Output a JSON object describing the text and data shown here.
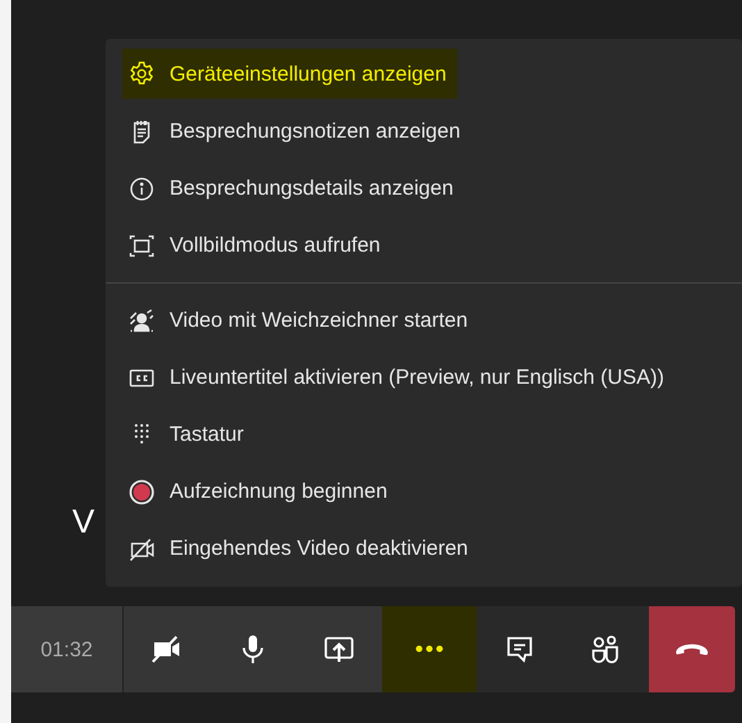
{
  "background_text": "V",
  "menu": {
    "groups": [
      [
        {
          "kind": "settings",
          "label": "Geräteeinstellungen anzeigen",
          "selected": true
        },
        {
          "kind": "notes",
          "label": "Besprechungsnotizen anzeigen",
          "selected": false
        },
        {
          "kind": "info",
          "label": "Besprechungsdetails anzeigen",
          "selected": false
        },
        {
          "kind": "fullscreen",
          "label": "Vollbildmodus aufrufen",
          "selected": false
        }
      ],
      [
        {
          "kind": "blur",
          "label": "Video mit Weichzeichner starten",
          "selected": false
        },
        {
          "kind": "captions",
          "label": "Liveuntertitel aktivieren (Preview, nur Englisch (USA))",
          "selected": false
        },
        {
          "kind": "keypad",
          "label": "Tastatur",
          "selected": false
        },
        {
          "kind": "record",
          "label": "Aufzeichnung beginnen",
          "selected": false
        },
        {
          "kind": "video-off",
          "label": "Eingehendes Video deaktivieren",
          "selected": false
        }
      ]
    ]
  },
  "toolbar": {
    "timer": "01:32",
    "buttons": [
      {
        "kind": "camera-off",
        "selected": false
      },
      {
        "kind": "mic",
        "selected": false
      },
      {
        "kind": "share",
        "selected": false
      },
      {
        "kind": "more",
        "selected": true
      },
      {
        "kind": "chat",
        "selected": false
      },
      {
        "kind": "people",
        "selected": false
      },
      {
        "kind": "hangup",
        "selected": false
      }
    ]
  }
}
